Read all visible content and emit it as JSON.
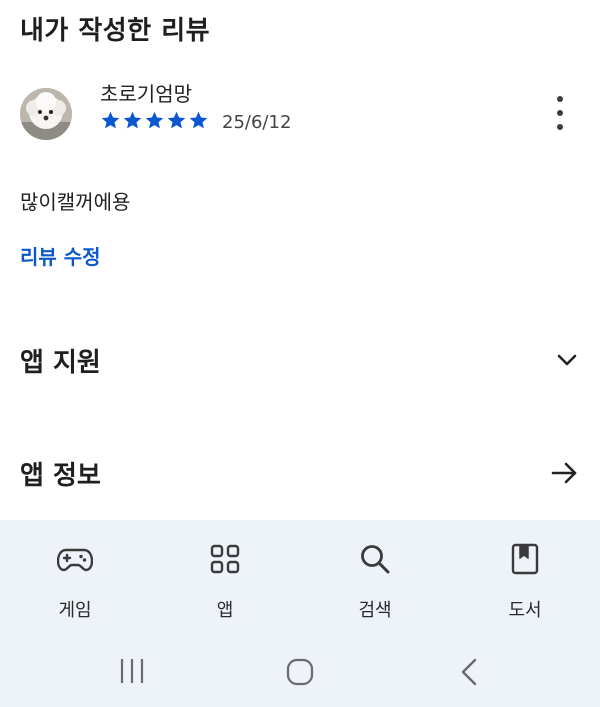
{
  "section": {
    "title": "내가 작성한 리뷰"
  },
  "review": {
    "reviewer_name": "초로기엄망",
    "rating": 5,
    "max_rating": 5,
    "date": "25/6/12",
    "text": "많이캘꺼에용",
    "edit_label": "리뷰 수정",
    "star_color": "#0b57d0"
  },
  "rows": {
    "app_support": {
      "label": "앱 지원",
      "icon": "chevron-down-icon"
    },
    "app_info": {
      "label": "앱 정보",
      "icon": "arrow-right-icon"
    }
  },
  "bottom_nav": {
    "items": [
      {
        "label": "게임",
        "icon": "gamepad-icon"
      },
      {
        "label": "앱",
        "icon": "apps-grid-icon"
      },
      {
        "label": "검색",
        "icon": "search-icon"
      },
      {
        "label": "도서",
        "icon": "book-icon"
      }
    ]
  },
  "system_nav": {
    "buttons": [
      "recent-apps-icon",
      "home-icon",
      "back-icon"
    ]
  },
  "colors": {
    "accent": "#0b57d0",
    "bottom_bar": "#eef2f9",
    "text": "#1f1f1f"
  }
}
